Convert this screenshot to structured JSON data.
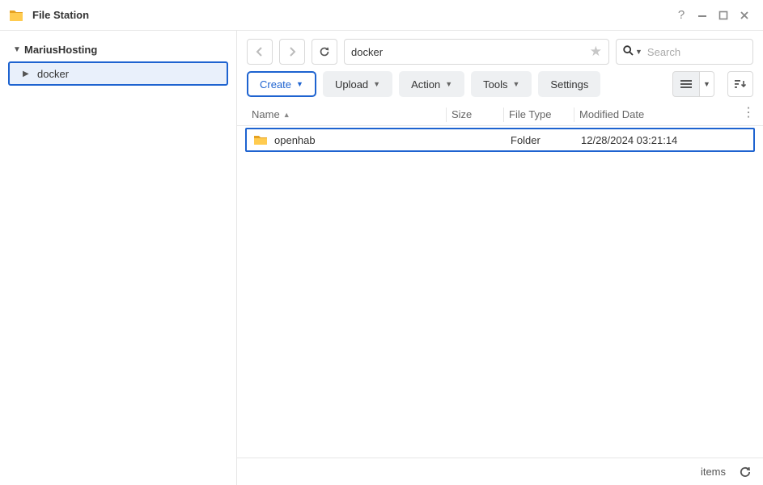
{
  "titlebar": {
    "title": "File Station"
  },
  "sidebar": {
    "root_label": "MariusHosting",
    "items": [
      {
        "label": "docker"
      }
    ]
  },
  "nav": {
    "path_value": "docker"
  },
  "search": {
    "placeholder": "Search"
  },
  "toolbar": {
    "create_label": "Create",
    "upload_label": "Upload",
    "action_label": "Action",
    "tools_label": "Tools",
    "settings_label": "Settings"
  },
  "columns": {
    "name": "Name",
    "size": "Size",
    "type": "File Type",
    "date": "Modified Date"
  },
  "rows": [
    {
      "name": "openhab",
      "size": "",
      "type": "Folder",
      "date": "12/28/2024 03:21:14"
    }
  ],
  "status": {
    "items_label": "items"
  }
}
